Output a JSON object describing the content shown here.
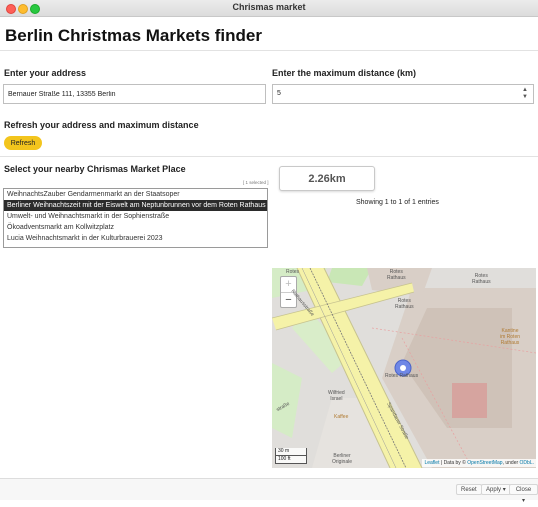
{
  "window": {
    "title": "Chrismas market"
  },
  "page": {
    "title": "Berlin Christmas Markets finder"
  },
  "address": {
    "label": "Enter your address",
    "value": "Bernauer Straße 111, 13355 Berlin"
  },
  "distance_input": {
    "label": "Enter the maximum distance (km)",
    "value": "5"
  },
  "refresh": {
    "heading": "Refresh your address and maximum distance",
    "button_label": "Refresh"
  },
  "markets": {
    "label": "Select your nearby Chrismas Market Place",
    "selected_count": "[ 1 selected ]",
    "options": [
      "WeihnachtsZauber Gendarmenmarkt an der Staatsoper",
      "Berliner Weihnachtszeit mit der Eiswelt am Neptunbrunnen vor dem Roten Rathaus",
      "Umwelt- und Weihnachtsmarkt in der Sophienstraße",
      "Ökoadventsmarkt am Kollwitzplatz",
      "Lucia Weihnachtsmarkt in der Kulturbrauerei 2023"
    ],
    "selected_index": 1
  },
  "result": {
    "distance": "2.26km",
    "entries_text": "Showing 1 to 1 of 1 entries"
  },
  "map": {
    "zoom_in": "+",
    "zoom_out": "−",
    "scale_m": "30 m",
    "scale_ft": "100 ft",
    "labels": {
      "rotes_rathaus_top_left": "Rotes",
      "rotes_rathaus_top": "Rotes\nRathaus",
      "rotes_rathaus_mid": "Rotes\nRathaus",
      "rotes_rathaus_marker": "Rotes Rathaus",
      "rathaus_right": "Rotes\nRathaus",
      "kantine": "Kantine\nim Roten\nRathaus",
      "street_left": "Rathausstraße",
      "spandauer": "Spandauer Straße",
      "straße_left": "straße",
      "wilfried": "Wilfried\nIsrael",
      "kaffee": "Kaffee",
      "berliner": "Berliner\nOriginale"
    },
    "attribution": {
      "leaflet": "Leaflet",
      "data_by": "| Data by ©",
      "osm": "OpenStreetMap",
      "under": ", under",
      "odbl": "ODbL."
    }
  },
  "footer": {
    "reset": "Reset",
    "apply": "Apply",
    "close": "Close"
  },
  "colors": {
    "accent": "#f3c51d",
    "selected_row": "#2b2b2b",
    "map_marker": "#6f87e6"
  }
}
